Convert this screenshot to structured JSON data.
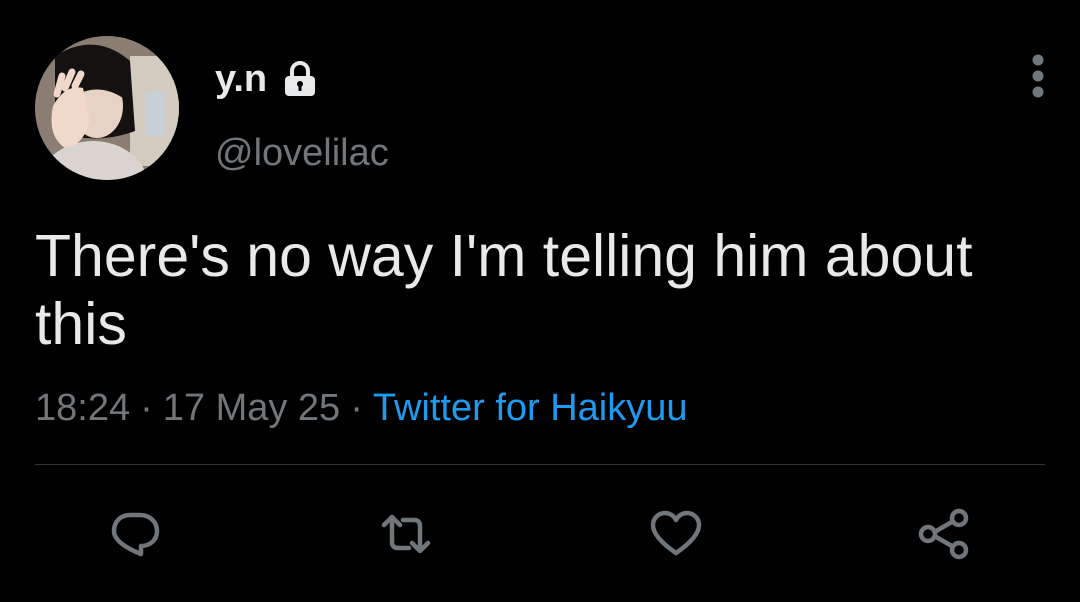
{
  "user": {
    "display_name": "y.n",
    "handle": "@lovelilac",
    "avatar_icon": "avatar-photo",
    "protected_icon": "lock-icon"
  },
  "tweet": {
    "text": "There's no way I'm telling him about this",
    "time": "18:24",
    "date": "17 May 25",
    "separator": "·",
    "source": "Twitter for Haikyuu"
  },
  "actions": {
    "reply_icon": "reply-icon",
    "retweet_icon": "retweet-icon",
    "like_icon": "heart-icon",
    "share_icon": "share-icon"
  },
  "colors": {
    "background": "#000000",
    "text_primary": "#e7e9ea",
    "text_secondary": "#71767b",
    "link": "#1d9bf0",
    "divider": "#2f3336"
  }
}
